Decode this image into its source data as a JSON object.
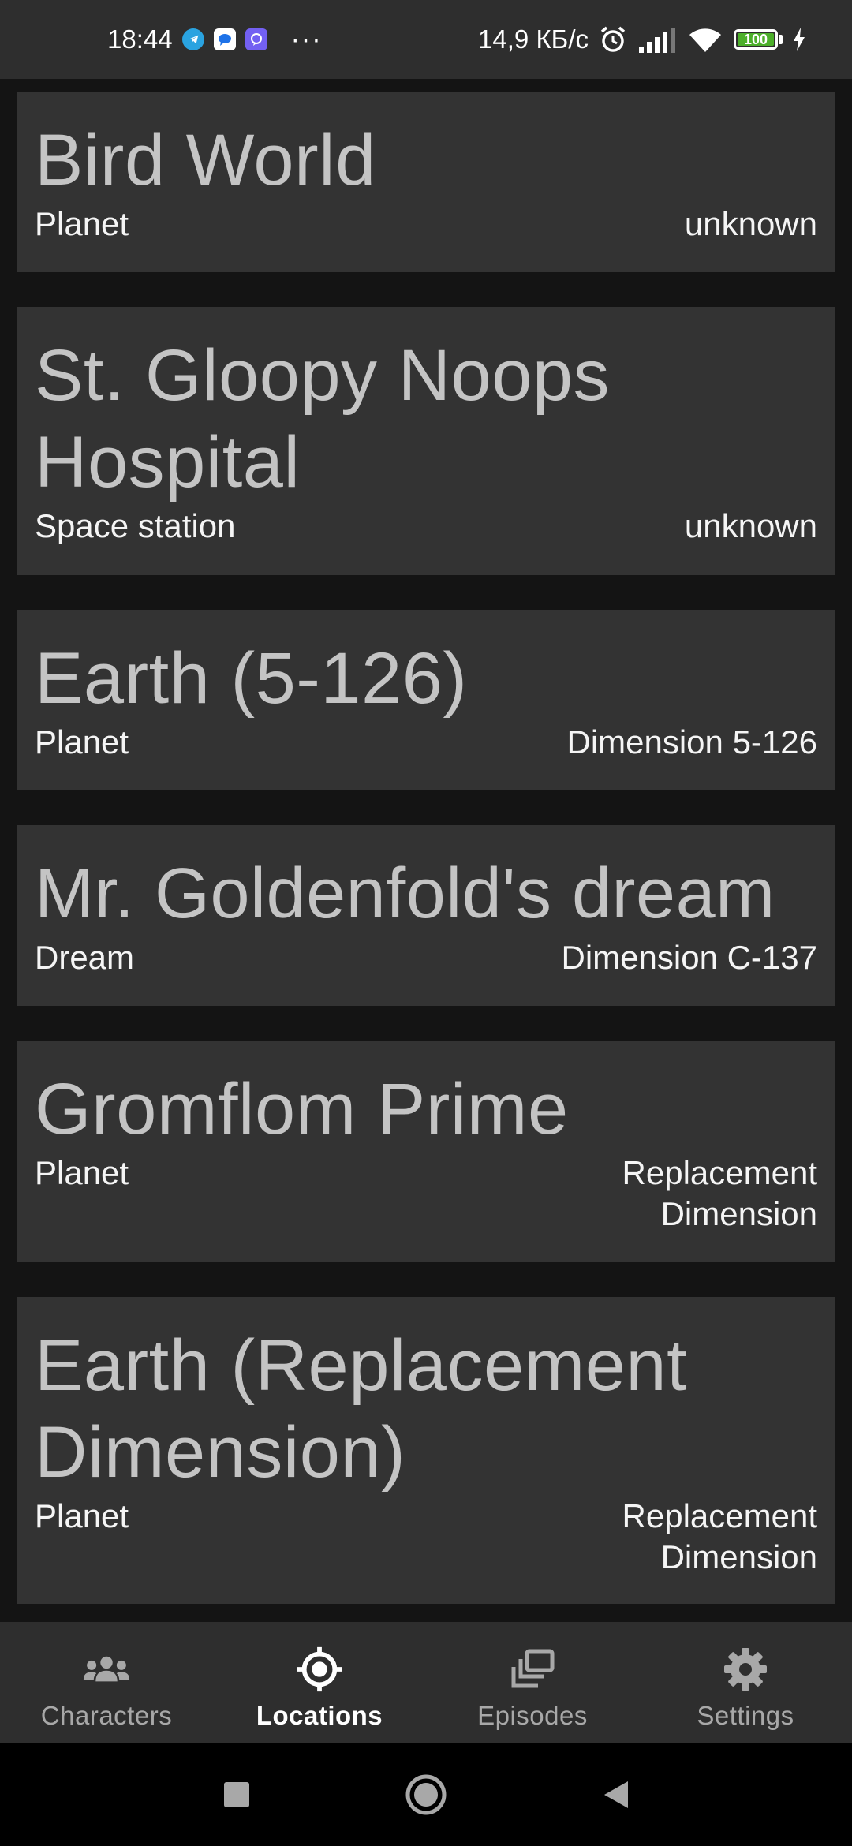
{
  "status_bar": {
    "time": "18:44",
    "network_speed": "14,9 КБ/с",
    "battery_level": "100",
    "icons": [
      "telegram-icon",
      "messages-icon",
      "viber-icon",
      "more-dots-icon",
      "alarm-icon",
      "signal-icon",
      "wifi-icon",
      "battery-icon",
      "charging-icon"
    ]
  },
  "locations": [
    {
      "name": "Bird World",
      "type": "Planet",
      "dimension": "unknown"
    },
    {
      "name": "St. Gloopy Noops Hospital",
      "type": "Space station",
      "dimension": "unknown"
    },
    {
      "name": "Earth (5-126)",
      "type": "Planet",
      "dimension": "Dimension 5-126"
    },
    {
      "name": "Mr. Goldenfold's dream",
      "type": "Dream",
      "dimension": "Dimension C-137"
    },
    {
      "name": "Gromflom Prime",
      "type": "Planet",
      "dimension": "Replacement Dimension"
    },
    {
      "name": "Earth (Replacement Dimension)",
      "type": "Planet",
      "dimension": "Replacement Dimension"
    }
  ],
  "bottom_nav": {
    "items": [
      {
        "label": "Characters",
        "icon": "people-icon",
        "active": false
      },
      {
        "label": "Locations",
        "icon": "location-target-icon",
        "active": true
      },
      {
        "label": "Episodes",
        "icon": "episodes-stack-icon",
        "active": false
      },
      {
        "label": "Settings",
        "icon": "gear-icon",
        "active": false
      }
    ]
  },
  "system_nav": {
    "icons": [
      "recents-square-icon",
      "home-circle-icon",
      "back-triangle-icon"
    ]
  },
  "colors": {
    "background": "#141414",
    "card": "#333333",
    "bar": "#2e2e2e",
    "title_text": "#c4c4c4",
    "inactive_nav": "#a8a8a8",
    "battery_green": "#4caf2a"
  }
}
